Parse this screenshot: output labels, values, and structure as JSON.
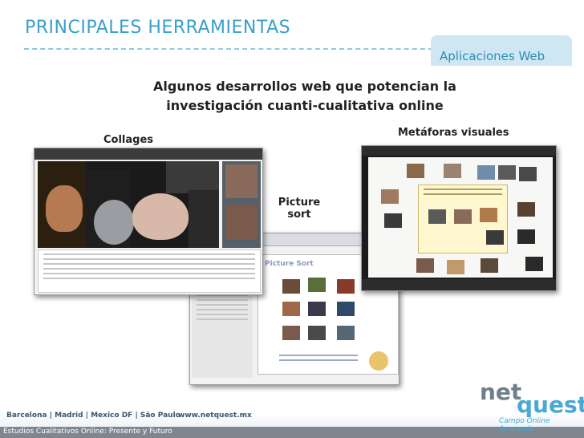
{
  "slide": {
    "title": "PRINCIPALES HERRAMIENTAS",
    "section_badge": "Aplicaciones Web",
    "subtitle_line1": "Algunos desarrollos web que potencian la",
    "subtitle_line2": "investigación cuanti-cualitativa online"
  },
  "tools": {
    "collages_label": "Collages",
    "picture_sort_label_line1": "Picture",
    "picture_sort_label_line2": "sort",
    "metaforas_label": "Metáforas visuales"
  },
  "screenshots": {
    "picture_sort_title": "Picture Sort"
  },
  "footer": {
    "cities": "Barcelona | Madrid | Mexico DF | São Paulo",
    "url": "www.netquest.mx",
    "caption": "Estudios Cualitativos Online: Presente y Futuro",
    "logo_net": "net",
    "logo_quest": "quest",
    "logo_tagline": "Campo Online Avanzado"
  },
  "colors": {
    "accent": "#3a9fc9",
    "badge_bg": "#cfe7f2",
    "footer_bar": "#7f8690"
  }
}
